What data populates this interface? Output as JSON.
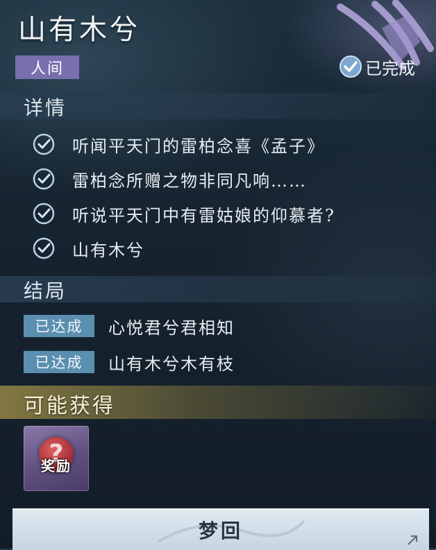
{
  "quest": {
    "title": "山有木兮",
    "tag": "人间",
    "status": "已完成"
  },
  "details": {
    "heading": "详情",
    "items": [
      "听闻平天门的雷柏念喜《孟子》",
      "雷柏念所赠之物非同凡响……",
      "听说平天门中有雷姑娘的仰慕者?",
      "山有木兮"
    ]
  },
  "endings": {
    "heading": "结局",
    "items": [
      {
        "badge": "已达成",
        "text": "心悦君兮君相知"
      },
      {
        "badge": "已达成",
        "text": "山有木兮木有枝"
      }
    ]
  },
  "rewards": {
    "heading": "可能获得",
    "item_label": "奖励"
  },
  "action": {
    "button_label": "梦回"
  },
  "icons": {
    "status": "check-circle-icon",
    "detail_item": "check-circle-icon",
    "reward": "question-mark-icon",
    "decoration": "purple-emblem-icon"
  },
  "colors": {
    "tag_bg": "#7a6fae",
    "badge_bg": "#5b8fb0",
    "reward_card": "#6b5a8c",
    "button_bg": "#d3dfe9"
  }
}
